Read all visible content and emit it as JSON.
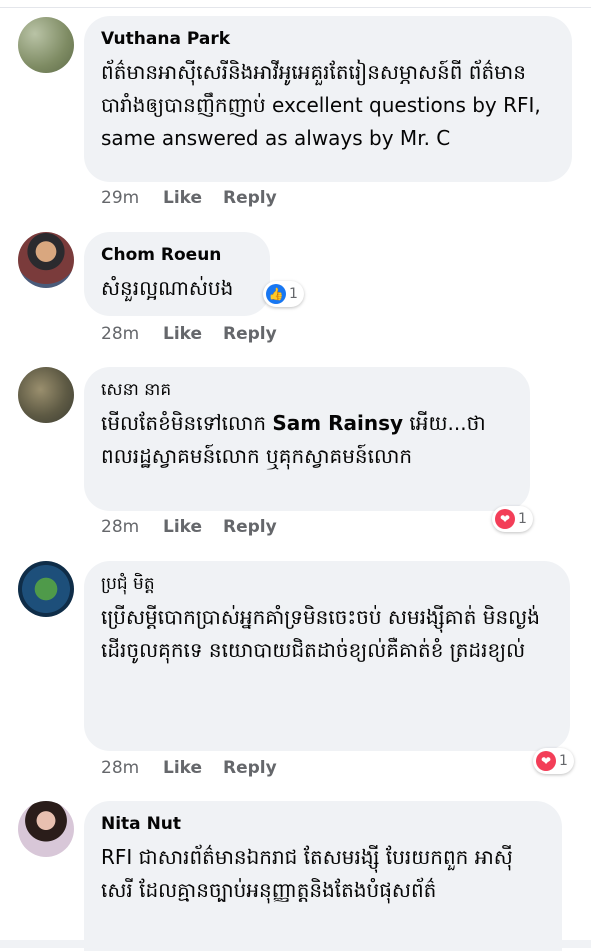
{
  "comments": [
    {
      "author": "Vuthana Park",
      "text": "ព័ត៌មានអាស៊ីសេរីនិងអាវីអូអេគួរតែរៀនសម្ភាសន៍ពី ព័ត៌មានបារាំងឲ្យបានញឹកញាប់ excellent questions by RFI, same answered as always by Mr. C",
      "time": "29m",
      "like_label": "Like",
      "reply_label": "Reply"
    },
    {
      "author": "Chom Roeun",
      "text": "សំនួរល្អណាស់បង",
      "time": "28m",
      "like_label": "Like",
      "reply_label": "Reply",
      "reaction": {
        "icon": "like-icon",
        "count": "1",
        "color": "#1877f2"
      }
    },
    {
      "author": "សេនា នាគ",
      "text_before": "មើលតែខំមិនទៅលោក ",
      "text_bold": "Sam Rainsy",
      "text_after": " អើយ...ថា ពលរដ្ឋស្វាគមន៍លោក ឬគុកស្វាគមន៍លោក",
      "time": "28m",
      "like_label": "Like",
      "reply_label": "Reply",
      "reaction": {
        "icon": "heart-icon",
        "count": "1",
        "color": "#f33e58"
      }
    },
    {
      "author": "ប្រជុំ មិត្ត",
      "text": "ប្រើសម្តីបោកប្រាស់អ្នកគាំទ្រមិនចេះចប់ សមរង្ស៊ីគាត់ មិនល្ងង់ដើរចូលគុកទេ នយោបាយជិតដាច់ខ្យល់គឺគាត់ខំ ត្រដរខ្យល់",
      "time": "28m",
      "like_label": "Like",
      "reply_label": "Reply",
      "reaction": {
        "icon": "heart-icon",
        "count": "1",
        "color": "#f33e58"
      }
    },
    {
      "author": "Nita Nut",
      "text": "RFI ជាសារព័ត៌មានឯករាជ  តែសមរង្ស៊ី បែរយកពួក អាស៊ីសេរី ដែលគ្មានច្បាប់អនុញ្ញាត្តនិងតែងបំផុសព័ត៌"
    }
  ]
}
